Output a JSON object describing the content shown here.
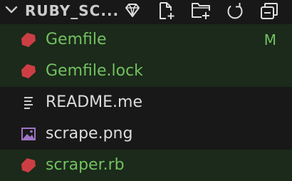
{
  "explorer": {
    "project_title": "RUBY_SC...",
    "toolbar": [
      {
        "name": "gem-icon"
      },
      {
        "name": "new-file-icon"
      },
      {
        "name": "new-folder-icon"
      },
      {
        "name": "refresh-icon"
      },
      {
        "name": "collapse-all-icon"
      }
    ],
    "files": [
      {
        "name": "Gemfile",
        "icon": "ruby-icon",
        "badge": "M",
        "modified": true
      },
      {
        "name": "Gemfile.lock",
        "icon": "ruby-icon",
        "badge": "",
        "modified": true
      },
      {
        "name": "README.me",
        "icon": "text-lines-icon",
        "badge": "",
        "modified": false
      },
      {
        "name": "scrape.png",
        "icon": "image-icon",
        "badge": "",
        "modified": false
      },
      {
        "name": "scraper.rb",
        "icon": "ruby-icon",
        "badge": "",
        "modified": true
      }
    ]
  },
  "colors": {
    "background": "#181818",
    "modified_text": "#73c161",
    "modified_row": "#1b2a1a",
    "ruby_icon": "#cc3e44",
    "image_icon": "#a074c4",
    "plain_text": "#dddddd"
  }
}
